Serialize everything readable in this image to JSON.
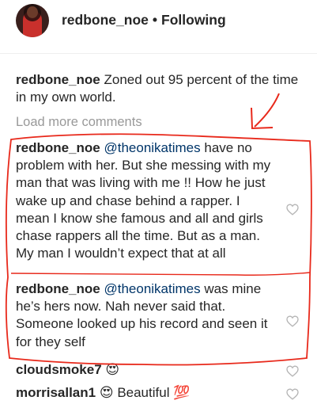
{
  "header": {
    "username": "redbone_noe",
    "separator": "•",
    "follow_status": "Following"
  },
  "caption": {
    "username": "redbone_noe",
    "text": "Zoned out 95 percent of the time in my own world."
  },
  "load_more": "Load more comments",
  "comments": [
    {
      "username": "redbone_noe",
      "mention": "@theonikatimes",
      "text": " have no problem with her. But she messing with my man that was living with me !! How he just wake up and chase behind a rapper. I mean I know she famous and all and girls chase rappers all the time. But as a man. My man I wouldn’t expect that at all"
    },
    {
      "username": "redbone_noe",
      "mention": "@theonikatimes",
      "text": " was mine he’s hers now. Nah never said that. Someone looked up his record and seen it for they self"
    },
    {
      "username": "cloudsmoke7",
      "emoji": "😍"
    },
    {
      "username": "morrisallan1",
      "emoji": "😍",
      "text": "Beautiful",
      "emoji2": "💯"
    }
  ],
  "icons": {
    "heart": "heart-outline-icon",
    "avatar": "profile-avatar"
  },
  "colors": {
    "text": "#262626",
    "mention": "#003569",
    "muted": "#999999",
    "annotation": "#e8291b",
    "heart": "#c7c7c7"
  }
}
